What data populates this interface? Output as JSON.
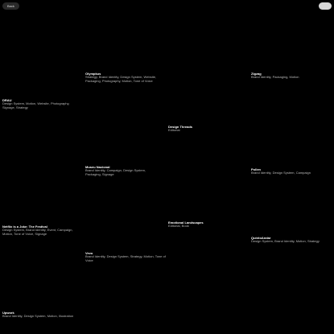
{
  "header": {
    "back_label": "Back"
  },
  "projects": [
    {
      "title": "Olympkus",
      "tags": "Strategy, Brand Identity, Design System, Website, Packaging, Photography, Motion, Tone of Voice"
    },
    {
      "title": "Zigzag",
      "tags": "Brand Identity, Packaging, Motion"
    },
    {
      "title": "DRAU",
      "tags": "Design System, Motion, Website, Photography, Signage, Strategy"
    },
    {
      "title": "Design Threads",
      "tags": "Editorial"
    },
    {
      "title": "Museu Nacional",
      "tags": "Brand Identity, Campaign, Design System, Packaging, Signage"
    },
    {
      "title": "Pollen",
      "tags": "Brand Identity, Design System, Campaign"
    },
    {
      "title": "Emotional Landscapes",
      "tags": "Editorial, Book"
    },
    {
      "title": "Netflix is a Joke: The Festival",
      "tags": "Design System, Brand Identity, Event, Campaign, Motion, Tone of Voice, Signage"
    },
    {
      "title": "QuintoAndar",
      "tags": "Design System, Brand Identity, Motion, Strategy"
    },
    {
      "title": "Vevo",
      "tags": "Brand Identity, Design System, Strategy, Motion, Tone of Voice"
    },
    {
      "title": "Upwork",
      "tags": "Brand Identity, Design System, Motion, Illustration"
    }
  ]
}
